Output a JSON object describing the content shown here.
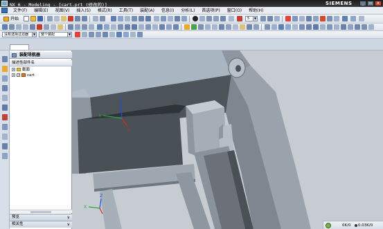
{
  "window": {
    "title": "NX 6 - Modeling - [cart.prt (修改的)]",
    "brand": "SIEMENS",
    "controls": [
      "_",
      "▫",
      "x"
    ]
  },
  "menu": {
    "items": [
      "文件(F)",
      "编辑(E)",
      "视图(V)",
      "插入(S)",
      "格式(R)",
      "工具(T)",
      "装配(A)",
      "信息(I)",
      "分析(L)",
      "首选项(P)",
      "窗口(O)",
      "帮助(H)"
    ]
  },
  "toolbar": {
    "start_label": "开始",
    "filter_combo": "没有选择过滤器",
    "scope_combo": "整个装配",
    "layer_value": "5"
  },
  "navigator": {
    "title": "装配导航器",
    "column_header": "描述性部件名",
    "nodes": [
      {
        "label": "截面",
        "expander": "+",
        "checked": false
      },
      {
        "label": "cart",
        "expander": "+",
        "checked": true
      }
    ],
    "panels": [
      "预览",
      "相关性"
    ]
  },
  "viewport": {
    "triad_labels": {
      "x": "X",
      "y": "Y",
      "z": "Z"
    },
    "colors": {
      "background": "#c7ccd3",
      "body_light": "#a9b1bb",
      "body_mid": "#8e969f",
      "body_dark": "#4d5459",
      "shadow": "#3c4246"
    }
  },
  "status": {
    "left": "0K/0",
    "right": "0.03K/0"
  }
}
